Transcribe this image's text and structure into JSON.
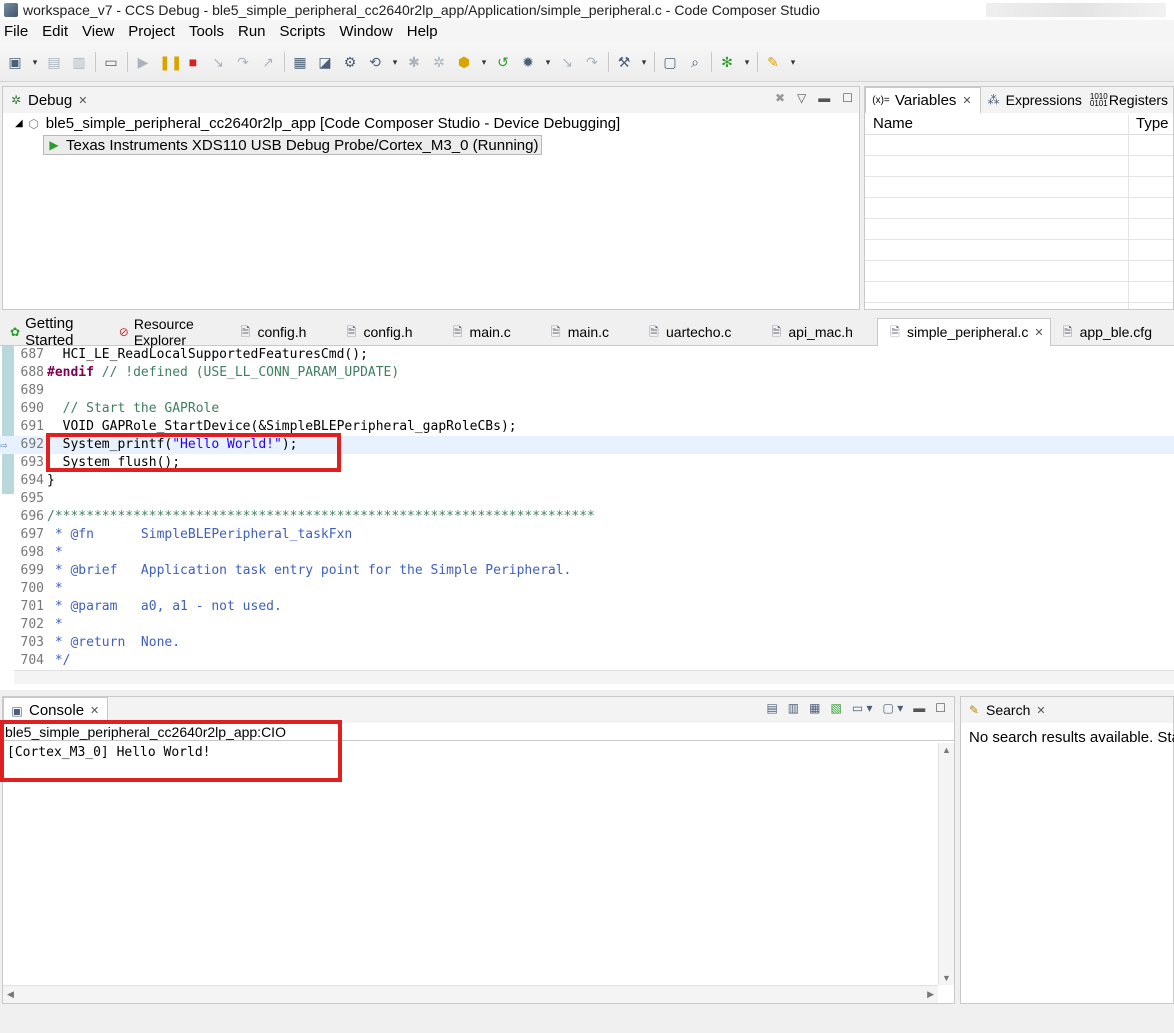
{
  "window": {
    "title": "workspace_v7 - CCS Debug - ble5_simple_peripheral_cc2640r2lp_app/Application/simple_peripheral.c - Code Composer Studio"
  },
  "menu": [
    "File",
    "Edit",
    "View",
    "Project",
    "Tools",
    "Run",
    "Scripts",
    "Window",
    "Help"
  ],
  "debug": {
    "tab": "Debug",
    "project": "ble5_simple_peripheral_cc2640r2lp_app [Code Composer Studio - Device Debugging]",
    "target": "Texas Instruments XDS110 USB Debug Probe/Cortex_M3_0 (Running)"
  },
  "variables": {
    "tabs": [
      "Variables",
      "Expressions",
      "Registers"
    ],
    "columns": [
      "Name",
      "Type"
    ]
  },
  "editor": {
    "tabs": [
      "Getting Started",
      "Resource Explorer",
      "config.h",
      "config.h",
      "main.c",
      "main.c",
      "uartecho.c",
      "api_mac.h",
      "simple_peripheral.c",
      "app_ble.cfg"
    ],
    "lines": [
      {
        "n": "687",
        "text": "  HCI_LE_ReadLocalSupportedFeaturesCmd();"
      },
      {
        "n": "688",
        "pp": "#endif",
        "cm": " // !defined (USE_LL_CONN_PARAM_UPDATE)"
      },
      {
        "n": "689",
        "text": ""
      },
      {
        "n": "690",
        "cm": "  // Start the GAPRole"
      },
      {
        "n": "691",
        "text": "  VOID GAPRole_StartDevice(&SimpleBLEPeripheral_gapRoleCBs);"
      },
      {
        "n": "692",
        "pre": "  System_printf(",
        "str": "\"Hello World!\"",
        "post": ");"
      },
      {
        "n": "693",
        "text": "  System_flush();"
      },
      {
        "n": "694",
        "text": "}"
      },
      {
        "n": "695",
        "text": ""
      },
      {
        "n": "696",
        "cm": "/*********************************************************************"
      },
      {
        "n": "697",
        "doc": " * @fn      SimpleBLEPeripheral_taskFxn"
      },
      {
        "n": "698",
        "doc": " *"
      },
      {
        "n": "699",
        "doc": " * @brief   Application task entry point for the Simple Peripheral."
      },
      {
        "n": "700",
        "doc": " *"
      },
      {
        "n": "701",
        "doc": " * @param   a0, a1 - not used."
      },
      {
        "n": "702",
        "doc": " *"
      },
      {
        "n": "703",
        "doc": " * @return  None."
      },
      {
        "n": "704",
        "doc": " */"
      }
    ]
  },
  "console": {
    "tab": "Console",
    "session": "ble5_simple_peripheral_cc2640r2lp_app:CIO",
    "output": "[Cortex_M3_0] Hello World!"
  },
  "search": {
    "tab": "Search",
    "message": "No search results available. Sta"
  },
  "colors": {
    "highlight_box": "#e02020",
    "current_line": "#e8f2fe"
  }
}
